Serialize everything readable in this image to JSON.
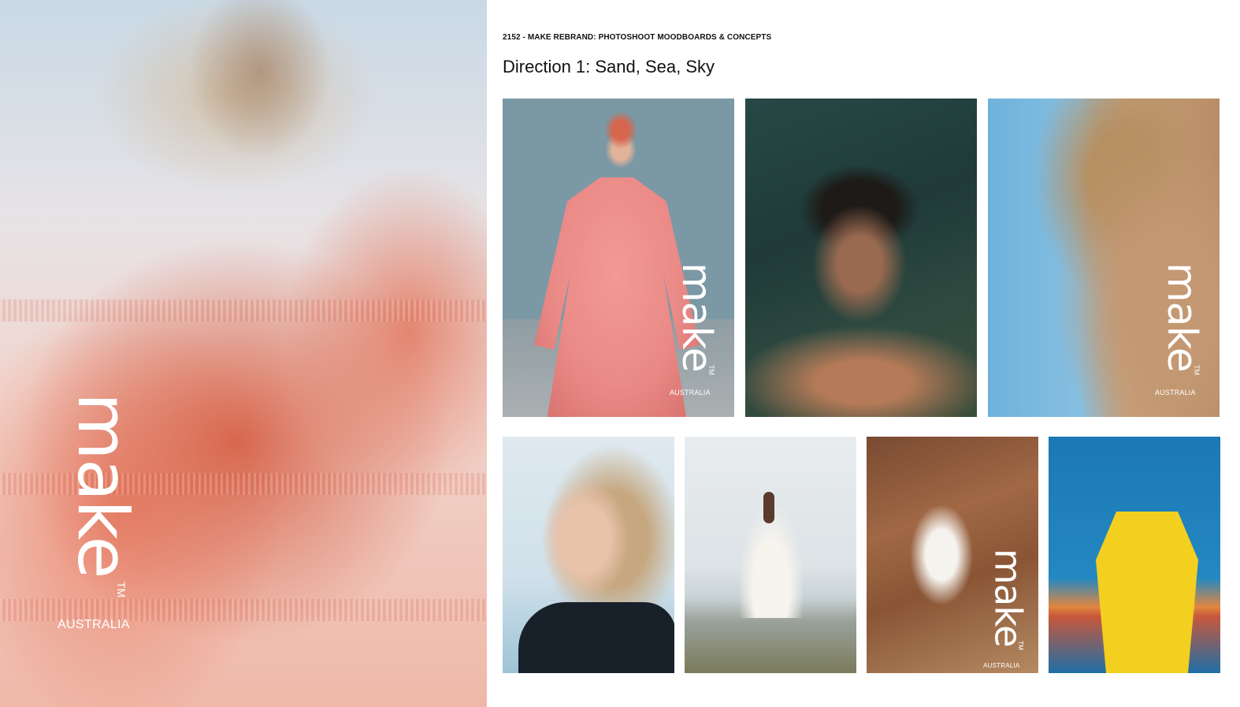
{
  "header": {
    "kicker": "2152 - MAKE REBRAND: PHOTOSHOOT MOODBOARDS & CONCEPTS",
    "title": "Direction 1: Sand, Sea, Sky"
  },
  "logo": {
    "word": "make",
    "tm": "TM",
    "region": "AUSTRALIA"
  },
  "colors": {
    "text": "#111111",
    "logo": "#ffffff"
  }
}
